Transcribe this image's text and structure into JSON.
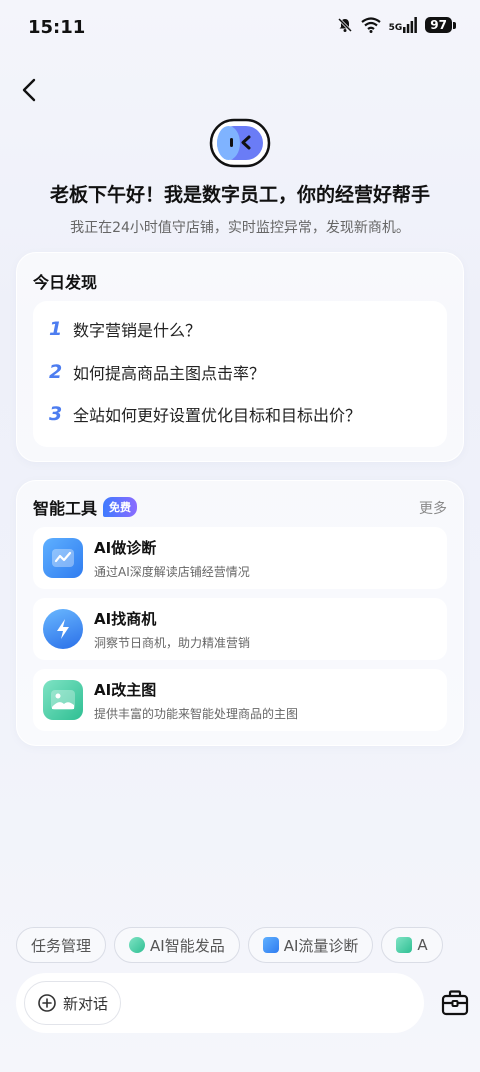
{
  "status": {
    "time": "15:11",
    "network": "5G",
    "battery": "97"
  },
  "header": {
    "greeting": "老板下午好！我是数字员工，你的经营好帮手",
    "subtitle": "我正在24小时值守店铺，实时监控异常，发现新商机。"
  },
  "discover": {
    "title": "今日发现",
    "items": [
      {
        "num": "1",
        "text": "数字营销是什么？"
      },
      {
        "num": "2",
        "text": "如何提高商品主图点击率？"
      },
      {
        "num": "3",
        "text": "全站如何更好设置优化目标和目标出价？"
      }
    ]
  },
  "tools": {
    "title": "智能工具",
    "badge": "免费",
    "more": "更多",
    "items": [
      {
        "name": "AI做诊断",
        "desc": "通过AI深度解读店铺经营情况",
        "icon": "chart-diagnosis-icon",
        "color": "#3d8cf5"
      },
      {
        "name": "AI找商机",
        "desc": "洞察节日商机，助力精准营销",
        "icon": "lightning-icon",
        "color": "#2f86f0"
      },
      {
        "name": "AI改主图",
        "desc": "提供丰富的功能来智能处理商品的主图",
        "icon": "image-edit-icon",
        "color": "#34c9a0"
      }
    ]
  },
  "chips": [
    {
      "label": "任务管理"
    },
    {
      "label": "AI智能发品"
    },
    {
      "label": "AI流量诊断"
    },
    {
      "label": "A"
    }
  ],
  "input": {
    "new_chat": "新对话"
  },
  "colors": {
    "accent": "#4d7df0",
    "badge_start": "#3f7bff",
    "badge_end": "#8b6bff"
  }
}
